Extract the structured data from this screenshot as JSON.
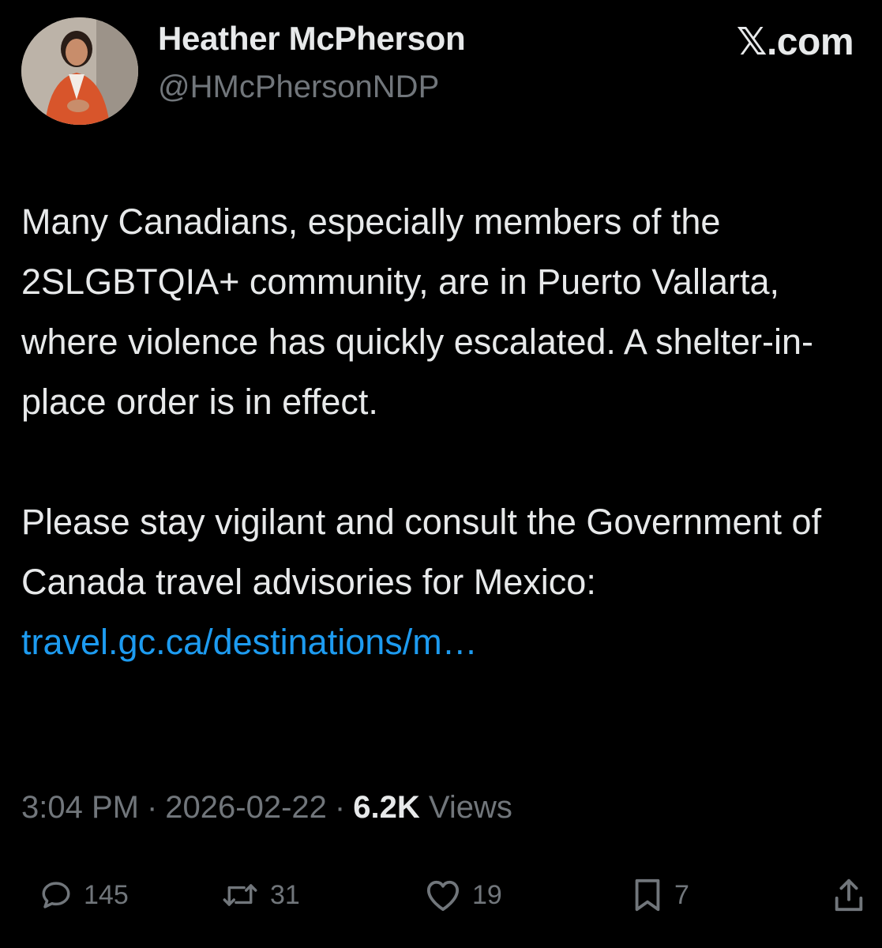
{
  "header": {
    "author_name": "Heather McPherson",
    "author_handle": "@HMcPhersonNDP",
    "brand_prefix": "𝕏",
    "brand_suffix": ".com"
  },
  "tweet": {
    "paragraph_1": "Many Canadians, especially members of the 2SLGBTQIA+ community, are in Puerto Vallarta, where violence has quickly escalated. A shelter-in-place order is in effect.",
    "paragraph_2_text": "Please stay vigilant and consult the Government of Canada travel advisories for Mexico: ",
    "paragraph_2_link": "travel.gc.ca/destinations/m…"
  },
  "meta": {
    "time": "3:04 PM",
    "date": "2026-02-22",
    "separator": "·",
    "views_count": "6.2K",
    "views_label": "Views"
  },
  "actions": {
    "replies": "145",
    "retweets": "31",
    "likes": "19",
    "bookmarks": "7"
  },
  "icons": {
    "reply": "speech-bubble-icon",
    "retweet": "retweet-arrows-icon",
    "like": "heart-icon",
    "bookmark": "bookmark-icon",
    "share": "share-upload-icon"
  },
  "colors": {
    "background": "#000000",
    "text": "#e7e9ea",
    "secondary": "#71767b",
    "link": "#1d9bf0"
  }
}
